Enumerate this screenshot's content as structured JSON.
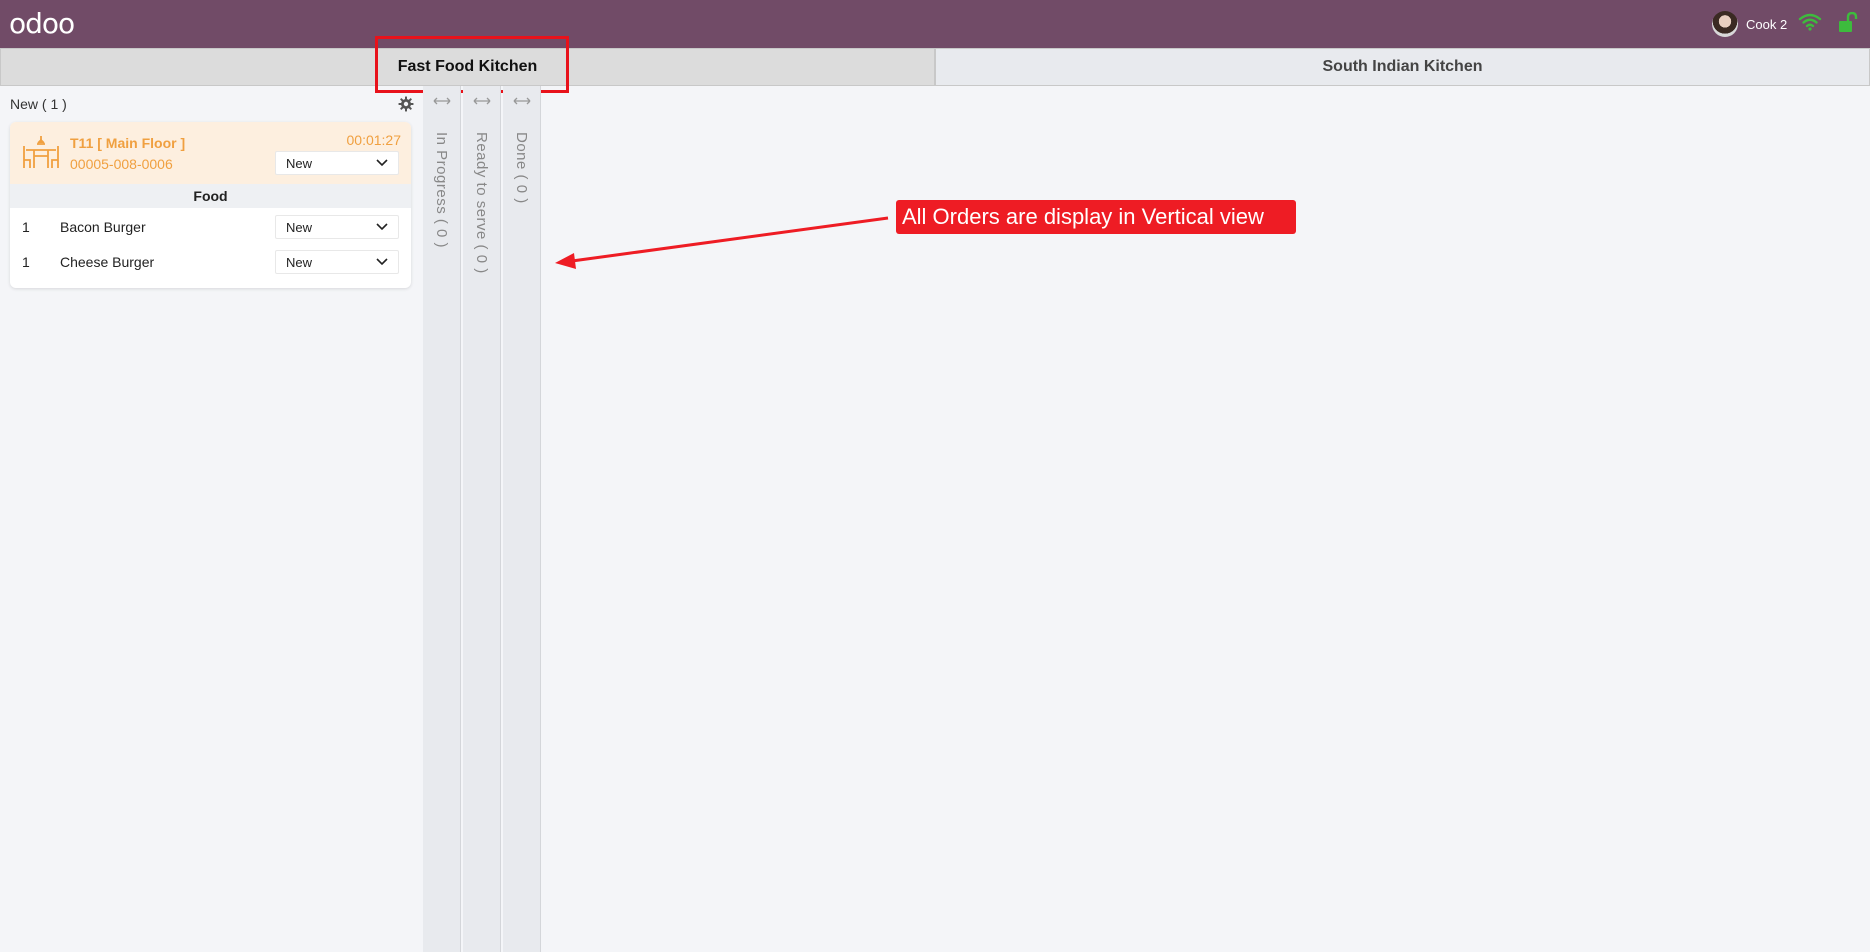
{
  "header": {
    "logo": "odoo",
    "user_name": "Cook 2",
    "colors": {
      "bar": "#714b67",
      "status_ok": "#3dbb3d"
    }
  },
  "tabs": [
    {
      "label": "Fast Food Kitchen",
      "active": true
    },
    {
      "label": "South Indian Kitchen",
      "active": false
    }
  ],
  "columns": {
    "new": {
      "header": "New ( 1 )",
      "orders": [
        {
          "table": "T11 [ Main Floor ]",
          "reference": "00005-008-0006",
          "timer": "00:01:27",
          "status": "New",
          "group": "Food",
          "lines": [
            {
              "qty": "1",
              "product": "Bacon Burger",
              "status": "New"
            },
            {
              "qty": "1",
              "product": "Cheese Burger",
              "status": "New"
            }
          ]
        }
      ]
    },
    "collapsed": [
      {
        "label": "In Progress ( 0 )"
      },
      {
        "label": "Ready to serve ( 0 )"
      },
      {
        "label": "Done ( 0 )"
      }
    ]
  },
  "annotation": {
    "text": "All Orders are display in Vertical view",
    "color": "#ee1c24"
  }
}
